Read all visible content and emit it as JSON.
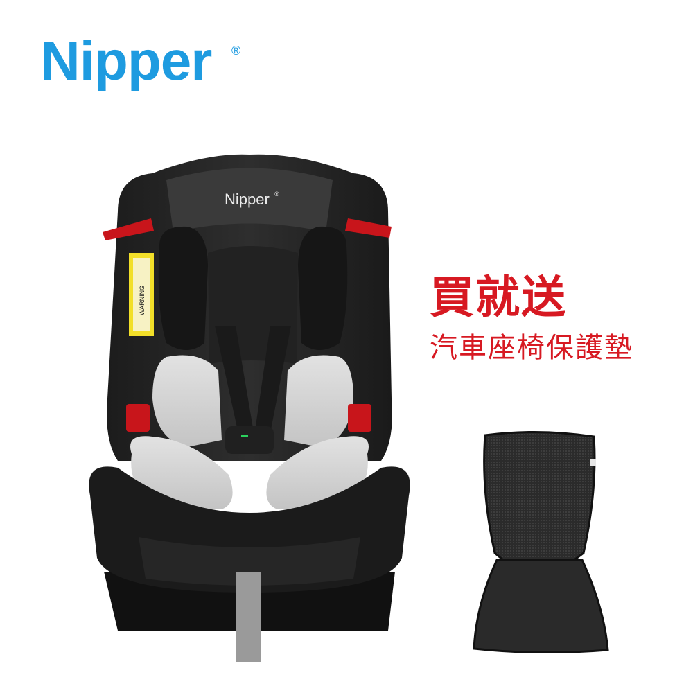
{
  "brand": {
    "logo_text": "Nipper",
    "registered_mark": "®",
    "color": "#1e9be0"
  },
  "product": {
    "seat_brand_label": "Nipper",
    "seat_brand_mark": "®",
    "warning_label_text": "WARNING"
  },
  "promo": {
    "headline": "買就送",
    "subline": "汽車座椅保護墊",
    "color": "#d71922"
  },
  "icons": {
    "seat": "car-seat-icon",
    "pad": "seat-protector-pad-icon"
  }
}
